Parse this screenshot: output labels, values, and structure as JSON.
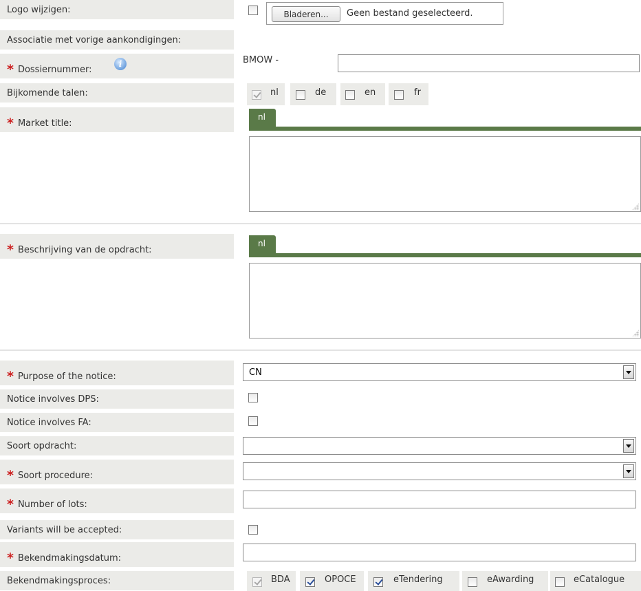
{
  "logo": {
    "label": "Logo wijzigen:",
    "browse_label": "Bladeren...",
    "file_status": "Geen bestand geselecteerd."
  },
  "association": {
    "label": "Associatie met vorige aankondigingen:"
  },
  "dossier": {
    "label": "Dossiernummer:",
    "prefix": "BMOW -",
    "value": "",
    "info_icon": "info-icon"
  },
  "languages": {
    "label": "Bijkomende talen:",
    "items": [
      {
        "code": "nl",
        "checked": true,
        "disabled": true
      },
      {
        "code": "de",
        "checked": false,
        "disabled": false
      },
      {
        "code": "en",
        "checked": false,
        "disabled": false
      },
      {
        "code": "fr",
        "checked": false,
        "disabled": false
      }
    ]
  },
  "market_title": {
    "label": "Market title:",
    "tab": "nl",
    "value": ""
  },
  "description": {
    "label": "Beschrijving van de opdracht:",
    "tab": "nl",
    "value": ""
  },
  "purpose": {
    "label": "Purpose of the notice:",
    "selected": "CN"
  },
  "dps": {
    "label": "Notice involves DPS:",
    "checked": false
  },
  "fa": {
    "label": "Notice involves FA:",
    "checked": false
  },
  "contract_type": {
    "label": "Soort opdracht:",
    "selected": ""
  },
  "procedure_type": {
    "label": "Soort procedure:",
    "selected": ""
  },
  "lots": {
    "label": "Number of lots:",
    "value": ""
  },
  "variants": {
    "label": "Variants will be accepted:",
    "checked": false
  },
  "publication_date": {
    "label": "Bekendmakingsdatum:",
    "value": ""
  },
  "publication_process": {
    "label": "Bekendmakingsproces:",
    "items": [
      {
        "name": "BDA",
        "checked": true,
        "disabled": true
      },
      {
        "name": "OPOCE",
        "checked": true,
        "disabled": false
      },
      {
        "name": "eTendering",
        "checked": true,
        "disabled": false
      },
      {
        "name": "eAwarding",
        "checked": false,
        "disabled": false
      },
      {
        "name": "eCatalogue",
        "checked": false,
        "disabled": false
      }
    ]
  },
  "required_marker": "*",
  "colors": {
    "tab": "#5a7a48",
    "required": "#cc1f1f",
    "label_bg": "#ebebe8"
  }
}
